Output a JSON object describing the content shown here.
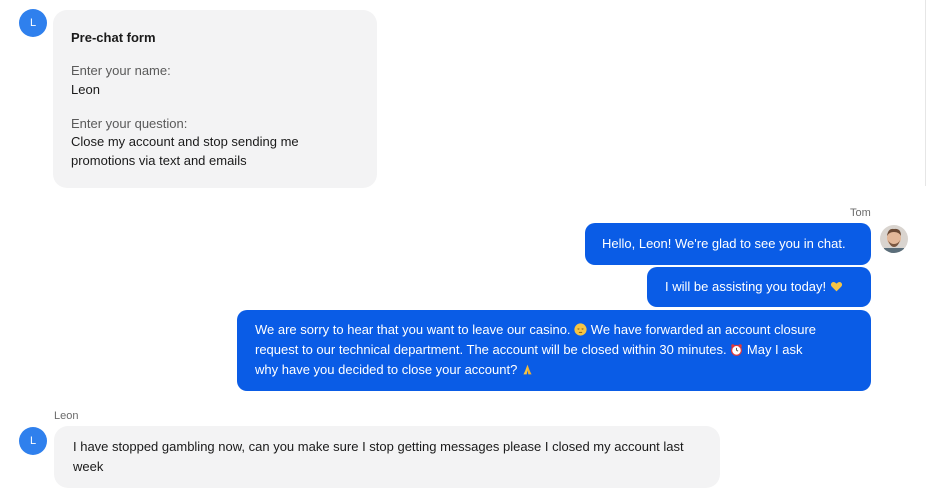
{
  "visitor": {
    "avatar_initial": "L",
    "name": "Leon"
  },
  "agent": {
    "name": "Tom"
  },
  "prechat_form": {
    "title": "Pre-chat form",
    "name_label": "Enter your name:",
    "name_value": "Leon",
    "question_label": "Enter your question:",
    "question_line1": "Close my account and stop sending me",
    "question_line2": "promotions via text and emails"
  },
  "agent_messages": {
    "greeting": "Hello, Leon! We're glad to see you in chat.",
    "assisting": "I will be assisting you today!",
    "closure_line1": "We are sorry to hear that you want to leave our casino.",
    "closure_line1b": "We have forwarded an account closure",
    "closure_line2": "request to our technical department. The account will be closed within 30 minutes.",
    "closure_line2b": "May I ask",
    "closure_line3": "why have you decided to close your account?"
  },
  "visitor_messages": {
    "reply_line1": "I have stopped gambling now, can you make sure I stop getting messages please I closed my account last",
    "reply_line2": "week"
  },
  "emojis": {
    "heart": "yellow-heart-icon",
    "sad": "pensive-face-icon",
    "clock": "alarm-clock-icon",
    "pray": "folded-hands-icon"
  },
  "colors": {
    "agent_bubble": "#0a5ce6",
    "visitor_bubble": "#f3f3f4",
    "avatar": "#2f80ed"
  }
}
